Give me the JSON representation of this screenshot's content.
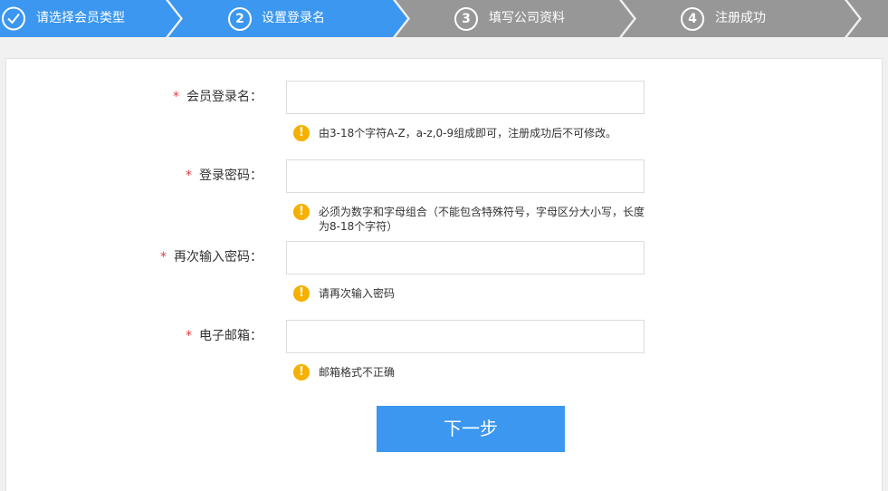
{
  "colors": {
    "active": "#3b97f0",
    "inactive": "#979797",
    "required": "#e4393c",
    "warning": "#f5b000"
  },
  "steps": [
    {
      "number": "",
      "icon": "check-icon",
      "label": "请选择会员类型",
      "state": "done"
    },
    {
      "number": "2",
      "label": "设置登录名",
      "state": "active"
    },
    {
      "number": "3",
      "label": "填写公司资料",
      "state": "pending"
    },
    {
      "number": "4",
      "label": "注册成功",
      "state": "pending"
    }
  ],
  "form": {
    "required_mark": "*",
    "fields": [
      {
        "label": "会员登录名：",
        "value": "",
        "placeholder": "",
        "hint": "由3-18个字符A-Z，a-z,0-9组成即可，注册成功后不可修改。"
      },
      {
        "label": "登录密码：",
        "value": "",
        "placeholder": "",
        "hint": "必须为数字和字母组合（不能包含特殊符号，字母区分大小写，长度为8-18个字符）"
      },
      {
        "label": "再次输入密码：",
        "value": "",
        "placeholder": "",
        "hint": "请再次输入密码"
      },
      {
        "label": "电子邮箱：",
        "value": "",
        "placeholder": "",
        "hint": "邮箱格式不正确"
      }
    ],
    "hint_icon": "!",
    "next_button": "下一步"
  }
}
